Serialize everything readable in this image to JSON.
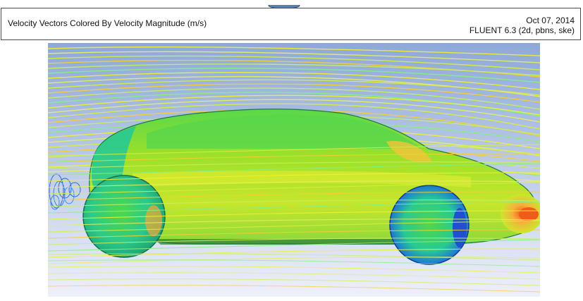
{
  "header": {
    "title": "Velocity Vectors Colored By Velocity Magnitude (m/s)",
    "date": "Oct 07, 2014",
    "version": "FLUENT 6.3 (2d, pbns, ske)"
  },
  "viewport": {
    "background_top": "#8ea8d8",
    "background_bottom": "#eef0fa",
    "streamline_colors": [
      "#f2f230",
      "#e8f060",
      "#d8ee40",
      "#f6d030",
      "#c8f060",
      "#88f080"
    ],
    "car_colors": [
      "#4fd848",
      "#8ee02c",
      "#c8e82c",
      "#27c994",
      "#f7b03a",
      "#f25a1c",
      "#2060d8"
    ]
  }
}
